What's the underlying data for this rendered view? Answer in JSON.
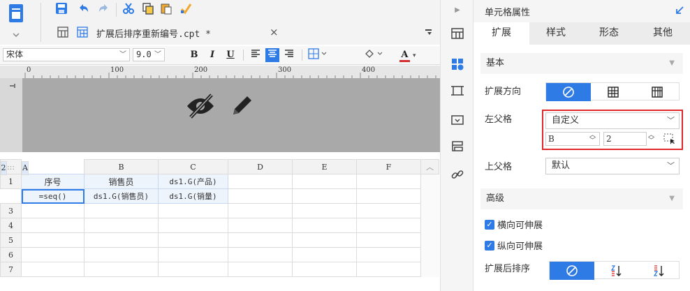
{
  "tab": {
    "file_name": "扩展后排序重新编号.cpt *",
    "close": "×"
  },
  "format_bar": {
    "font_family": "宋体",
    "font_size": "9.0",
    "bold": "B",
    "italic": "I",
    "underline": "U",
    "text_color_label": "A"
  },
  "ruler": {
    "ticks": [
      "0",
      "100",
      "200",
      "300",
      "400"
    ]
  },
  "sheet": {
    "columns": [
      "A",
      "B",
      "C",
      "D",
      "E",
      "F"
    ],
    "corner": ":::",
    "rows": [
      {
        "num": "1",
        "cells": [
          "序号",
          "销售员",
          "ds1.G(产品)",
          "",
          "",
          ""
        ]
      },
      {
        "num": "2",
        "cells": [
          "=seq()",
          "ds1.G(销售员)",
          "ds1.G(销量)",
          "",
          "",
          ""
        ]
      },
      {
        "num": "3",
        "cells": [
          "",
          "",
          "",
          "",
          "",
          ""
        ]
      },
      {
        "num": "4",
        "cells": [
          "",
          "",
          "",
          "",
          "",
          ""
        ]
      },
      {
        "num": "5",
        "cells": [
          "",
          "",
          "",
          "",
          "",
          ""
        ]
      },
      {
        "num": "6",
        "cells": [
          "",
          "",
          "",
          "",
          "",
          ""
        ]
      },
      {
        "num": "7",
        "cells": [
          "",
          "",
          "",
          "",
          "",
          ""
        ]
      }
    ]
  },
  "panel": {
    "title": "单元格属性",
    "tabs": [
      "扩展",
      "样式",
      "形态",
      "其他"
    ],
    "active_tab": "扩展",
    "section_basic": "基本",
    "expand_direction_label": "扩展方向",
    "left_parent_label": "左父格",
    "left_parent_value": "自定义",
    "left_parent_col": "B",
    "left_parent_row": "2",
    "top_parent_label": "上父格",
    "top_parent_value": "默认",
    "section_advanced": "高级",
    "horizontal_expand": "横向可伸展",
    "vertical_expand": "纵向可伸展",
    "sort_label": "扩展后排序"
  },
  "colors": {
    "accent": "#2f7be5",
    "highlight_border": "#e0272b"
  }
}
